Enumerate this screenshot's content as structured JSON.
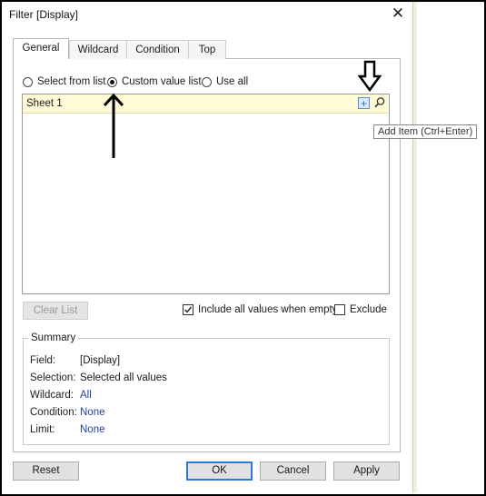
{
  "window": {
    "title": "Filter [Display]",
    "close_glyph": "✕"
  },
  "tabs": [
    {
      "label": "General",
      "selected": true
    },
    {
      "label": "Wildcard",
      "selected": false
    },
    {
      "label": "Condition",
      "selected": false
    },
    {
      "label": "Top",
      "selected": false
    }
  ],
  "radios": [
    {
      "label": "Select from list",
      "selected": false
    },
    {
      "label": "Custom value list",
      "selected": true
    },
    {
      "label": "Use all",
      "selected": false
    }
  ],
  "input": {
    "value": "Sheet 1",
    "add_glyph": "+"
  },
  "tooltip": "Add Item (Ctrl+Enter)",
  "clear_list": {
    "label": "Clear List",
    "enabled": false
  },
  "checkboxes": [
    {
      "label": "Include all values when empty",
      "checked": true
    },
    {
      "label": "Exclude",
      "checked": false
    }
  ],
  "summary": {
    "title": "Summary",
    "rows": [
      {
        "label": "Field:",
        "value": "[Display]",
        "blue": false
      },
      {
        "label": "Selection:",
        "value": "Selected all values",
        "blue": false
      },
      {
        "label": "Wildcard:",
        "value": "All",
        "blue": true
      },
      {
        "label": "Condition:",
        "value": "None",
        "blue": true
      },
      {
        "label": "Limit:",
        "value": "None",
        "blue": true
      }
    ]
  },
  "buttons": {
    "reset": "Reset",
    "ok": "OK",
    "cancel": "Cancel",
    "apply": "Apply"
  },
  "colors": {
    "input_highlight": "#fffbd6",
    "link_blue": "#1f3f9f",
    "focus_blue": "#2e78d6"
  }
}
